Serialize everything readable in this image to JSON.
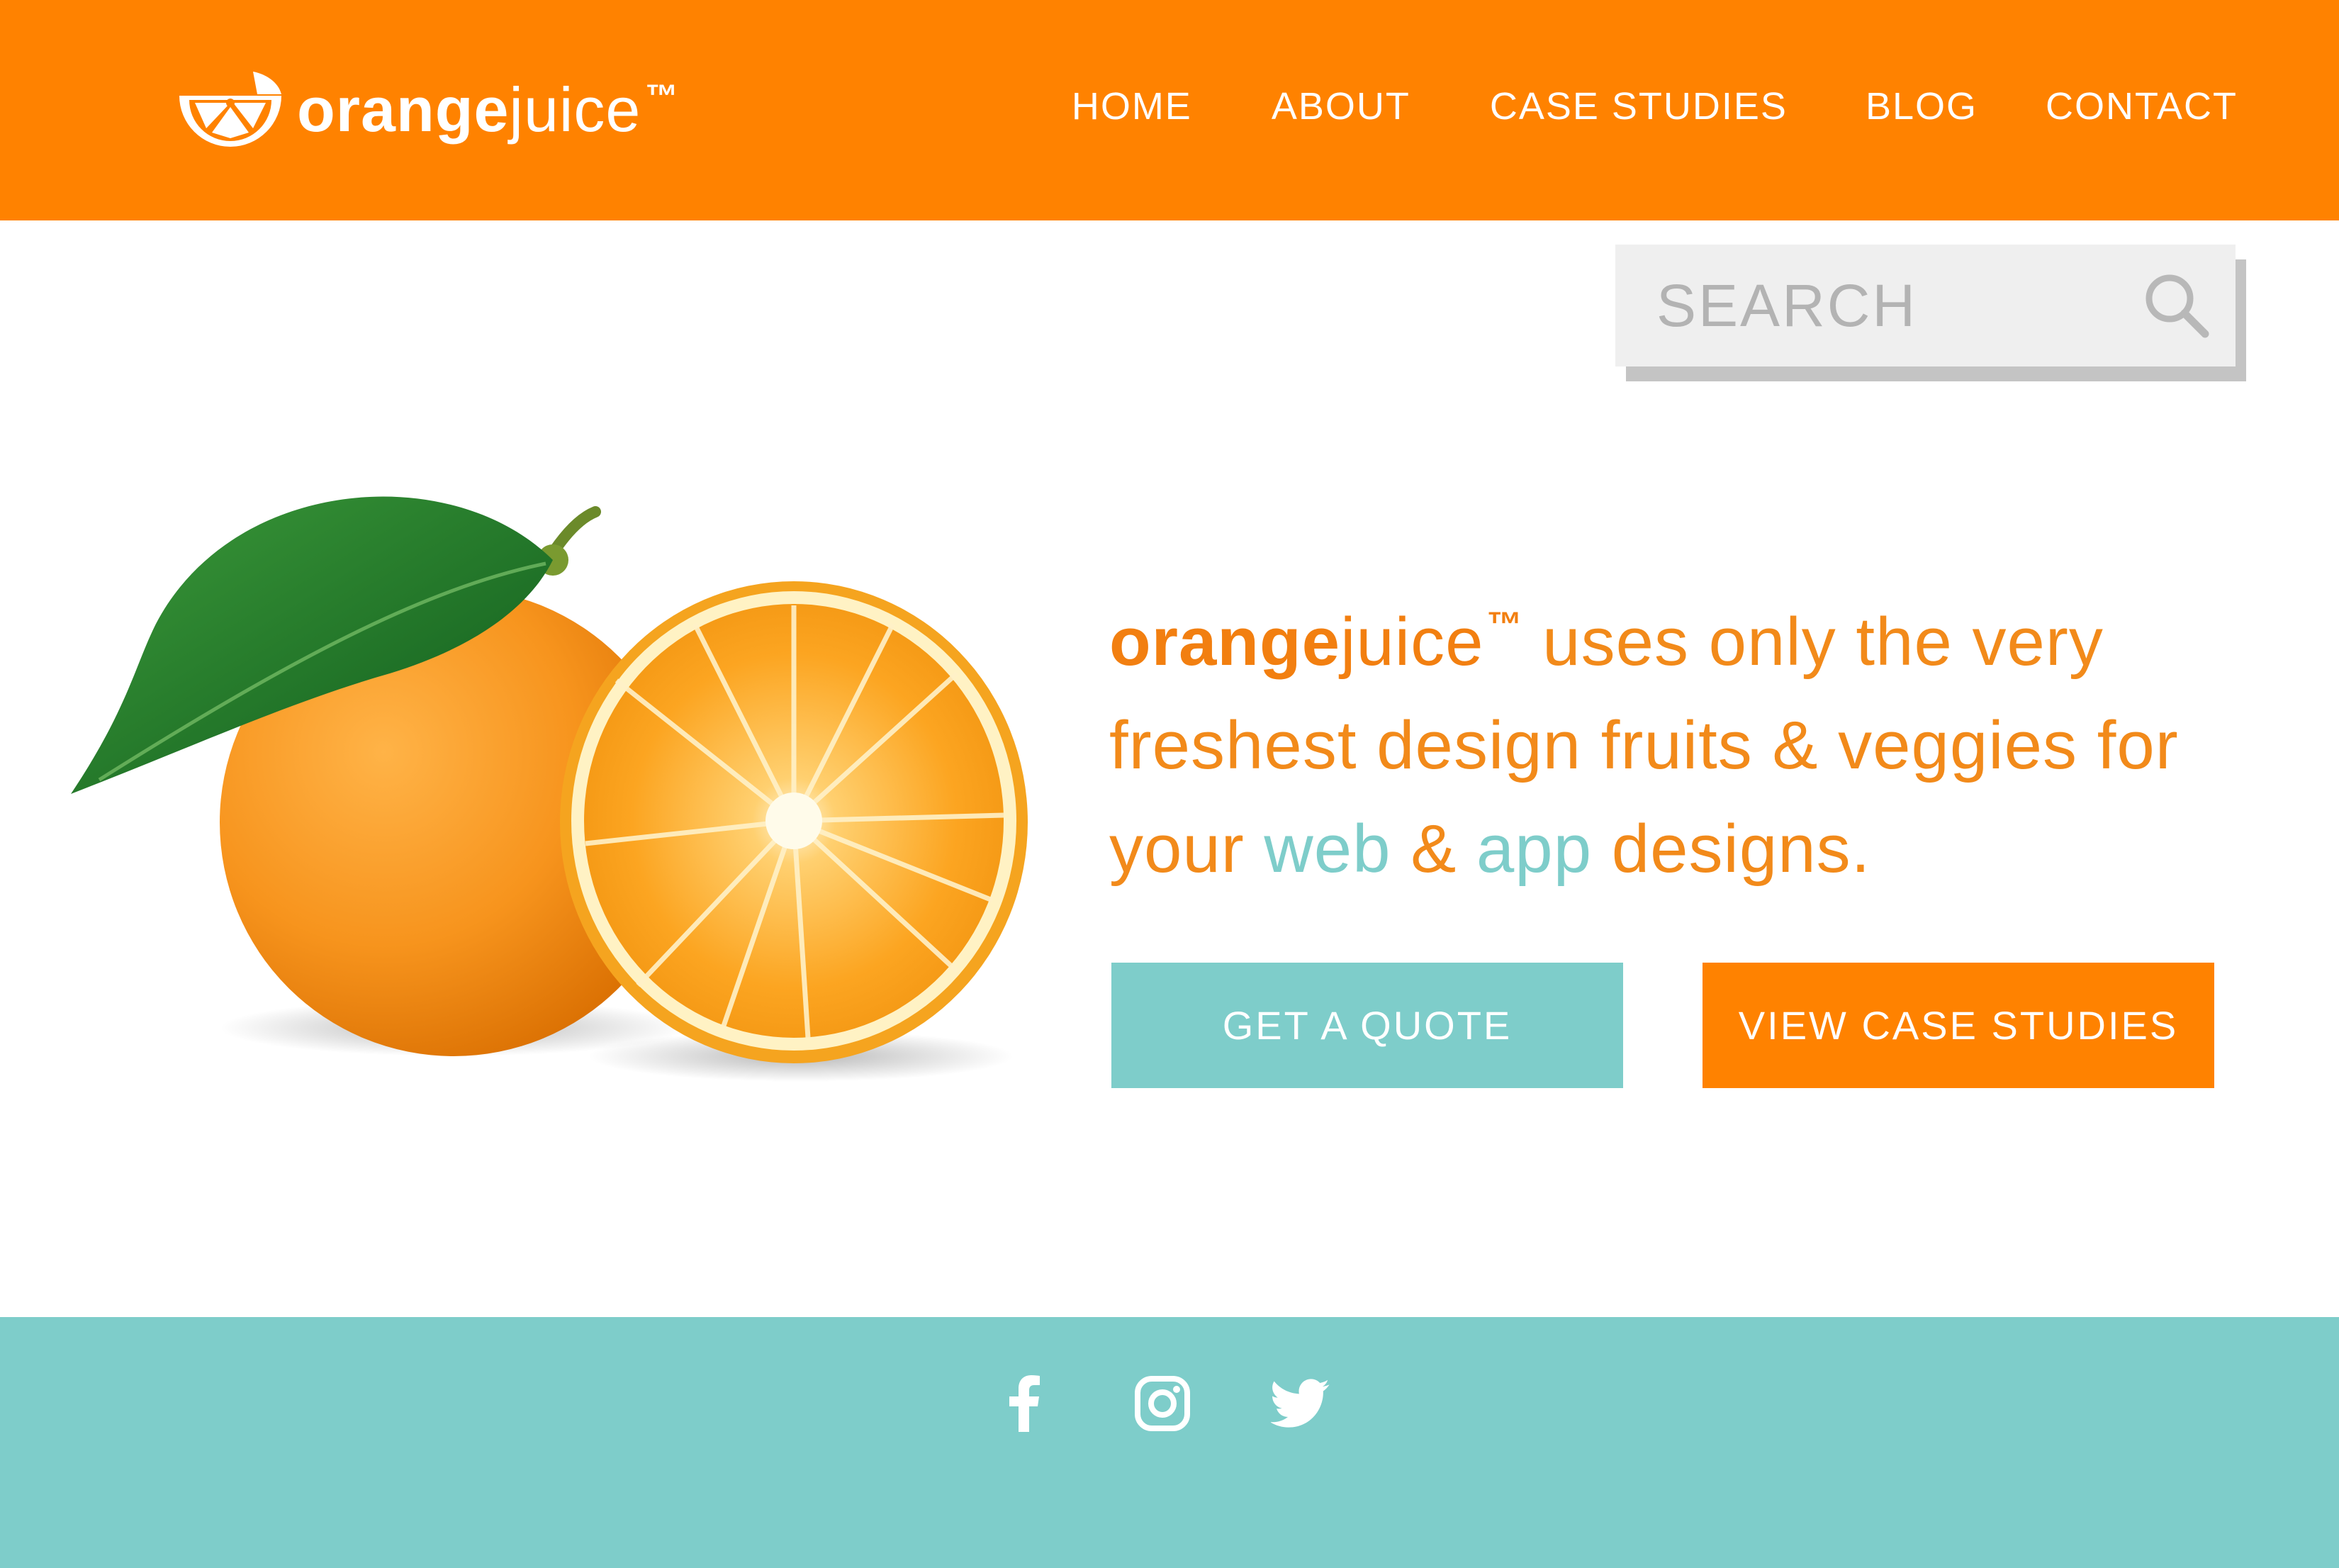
{
  "brand": {
    "name_bold": "orange",
    "name_light": "juice",
    "trademark": "™"
  },
  "nav": {
    "items": [
      {
        "label": "HOME"
      },
      {
        "label": "ABOUT"
      },
      {
        "label": "CASE STUDIES"
      },
      {
        "label": "BLOG"
      },
      {
        "label": "CONTACT"
      }
    ]
  },
  "search": {
    "placeholder": "SEARCH",
    "value": "",
    "icon": "search-icon"
  },
  "hero": {
    "image": "orange-fruit-with-leaf-and-half",
    "headline": {
      "brand_bold": "orange",
      "brand_light": "juice",
      "trademark": "™",
      "part1": " uses only the very freshest design fruits & veggies for your ",
      "accent1": "web",
      "part2": " & ",
      "accent2": "app",
      "part3": " designs."
    }
  },
  "buttons": {
    "quote_label": "GET A QUOTE",
    "case_studies_label": "VIEW CASE STUDIES"
  },
  "footer": {
    "social": [
      {
        "icon": "facebook-icon"
      },
      {
        "icon": "instagram-icon"
      },
      {
        "icon": "twitter-icon"
      }
    ]
  },
  "colors": {
    "brand_orange": "#ff8200",
    "headline_orange": "#f27f10",
    "teal": "#7ecdca",
    "search_bg": "#efefef",
    "search_shadow": "#c4c4c4",
    "white": "#ffffff"
  }
}
